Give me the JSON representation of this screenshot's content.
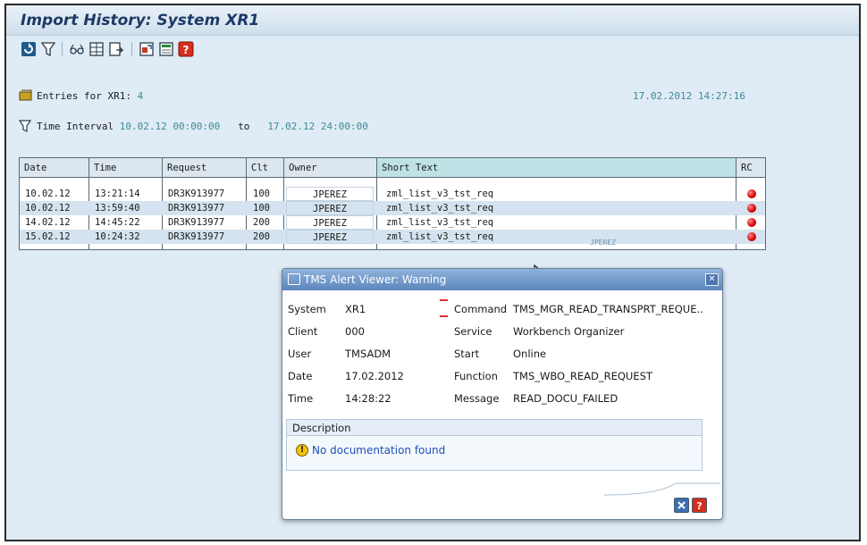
{
  "window": {
    "title": "Import History: System XR1"
  },
  "toolbar": {
    "icons": [
      "refresh-icon",
      "filter-icon",
      "glasses-icon",
      "details-icon",
      "export-icon",
      "transport-icon",
      "legend-icon",
      "help-icon"
    ]
  },
  "header": {
    "entries_label": "Entries for XR1:",
    "entries_count": "4",
    "timestamp": "17.02.2012 14:27:16",
    "interval_label": "Time Interval",
    "interval_from": "10.02.12 00:00:00",
    "interval_to_label": "to",
    "interval_to": "17.02.12 24:00:00"
  },
  "table": {
    "columns": [
      "Date",
      "Time",
      "Request",
      "Clt",
      "Owner",
      "Short Text",
      "RC"
    ],
    "rows": [
      {
        "date": "10.02.12",
        "time": "13:21:14",
        "request": "DR3K913977",
        "clt": "100",
        "owner": "JPEREZ",
        "short_text": "zml_list_v3_tst_req"
      },
      {
        "date": "10.02.12",
        "time": "13:59:40",
        "request": "DR3K913977",
        "clt": "100",
        "owner": "JPEREZ",
        "short_text": "zml_list_v3_tst_req"
      },
      {
        "date": "14.02.12",
        "time": "14:45:22",
        "request": "DR3K913977",
        "clt": "200",
        "owner": "JPEREZ",
        "short_text": "zml_list_v3_tst_req"
      },
      {
        "date": "15.02.12",
        "time": "10:24:32",
        "request": "DR3K913977",
        "clt": "200",
        "owner": "JPEREZ",
        "short_text": "zml_list_v3_tst_req"
      }
    ],
    "tooltip": "JPEREZ"
  },
  "dialog": {
    "title": "TMS Alert Viewer: Warning",
    "left": [
      {
        "label": "System",
        "value": "XR1"
      },
      {
        "label": "Client",
        "value": "000"
      },
      {
        "label": "User",
        "value": "TMSADM"
      },
      {
        "label": "Date",
        "value": "17.02.2012"
      },
      {
        "label": "Time",
        "value": "14:28:22"
      }
    ],
    "right": [
      {
        "label": "Command",
        "value": "TMS_MGR_READ_TRANSPRT_REQUE.."
      },
      {
        "label": "Service",
        "value": "Workbench Organizer"
      },
      {
        "label": "Start",
        "value": "Online"
      },
      {
        "label": "Function",
        "value": "TMS_WBO_READ_REQUEST"
      },
      {
        "label": "Message",
        "value": "READ_DOCU_FAILED"
      }
    ],
    "description_label": "Description",
    "description_text": "No documentation found",
    "status_color": "#d60000",
    "title_color": "#5d86bd"
  }
}
